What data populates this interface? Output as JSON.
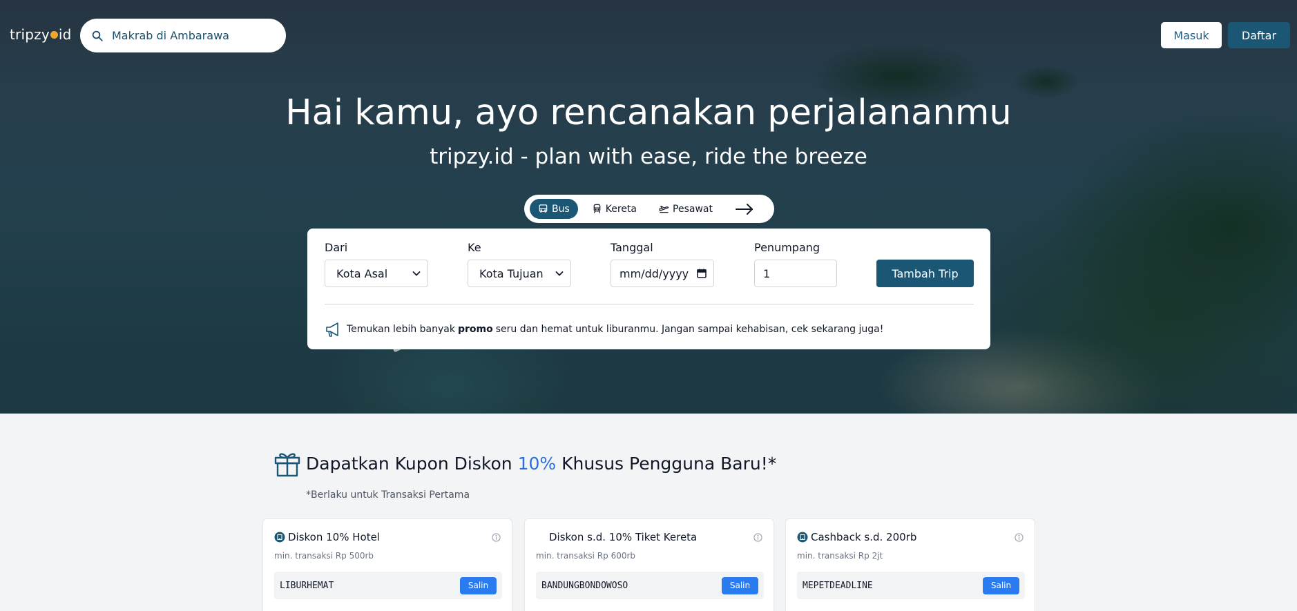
{
  "brand": {
    "logo_left": "tripzy",
    "logo_right": "id"
  },
  "search": {
    "value": "Makrab di Ambarawa"
  },
  "auth": {
    "login_label": "Masuk",
    "register_label": "Daftar"
  },
  "hero": {
    "title": "Hai kamu, ayo rencanakan perjalananmu",
    "subtitle": "tripzy.id - plan with ease, ride the breeze"
  },
  "modes": [
    {
      "label": "Bus",
      "icon": "bus-icon",
      "active": true
    },
    {
      "label": "Kereta",
      "icon": "train-icon",
      "active": false
    },
    {
      "label": "Pesawat",
      "icon": "plane-icon",
      "active": false
    }
  ],
  "form": {
    "from_label": "Dari",
    "from_value": "Kota Asal",
    "to_label": "Ke",
    "to_value": "Kota Tujuan",
    "date_label": "Tanggal",
    "date_placeholder": "mm/dd/yyyy",
    "pax_label": "Penumpang",
    "pax_value": "1",
    "submit_label": "Tambah Trip"
  },
  "promo": {
    "before": "Temukan lebih banyak ",
    "bold": "promo",
    "after": " seru dan hemat untuk liburanmu. Jangan sampai kehabisan, cek sekarang juga!"
  },
  "coupons": {
    "title_before": "Dapatkan Kupon Diskon ",
    "title_accent": "10%",
    "title_after": " Khusus Pengguna Baru!*",
    "note": "*Berlaku untuk Transaksi Pertama",
    "copy_label": "Salin",
    "items": [
      {
        "title": "Diskon 10% Hotel",
        "min": "min. transaksi Rp 500rb",
        "code": "LIBURHEMAT",
        "icon": "hotel-icon"
      },
      {
        "title": "Diskon s.d. 10% Tiket Kereta",
        "min": "min. transaksi Rp 600rb",
        "code": "BANDUNGBONDOWOSO",
        "icon": "train-icon"
      },
      {
        "title": "Cashback s.d. 200rb",
        "min": "min. transaksi Rp 2jt",
        "code": "MEPETDEADLINE",
        "icon": "hotel-icon"
      }
    ]
  },
  "colors": {
    "primary": "#1b5675",
    "accent": "#2a6fdb",
    "logo_dot": "#f4a62a",
    "copy_button": "#2a7bf0"
  }
}
